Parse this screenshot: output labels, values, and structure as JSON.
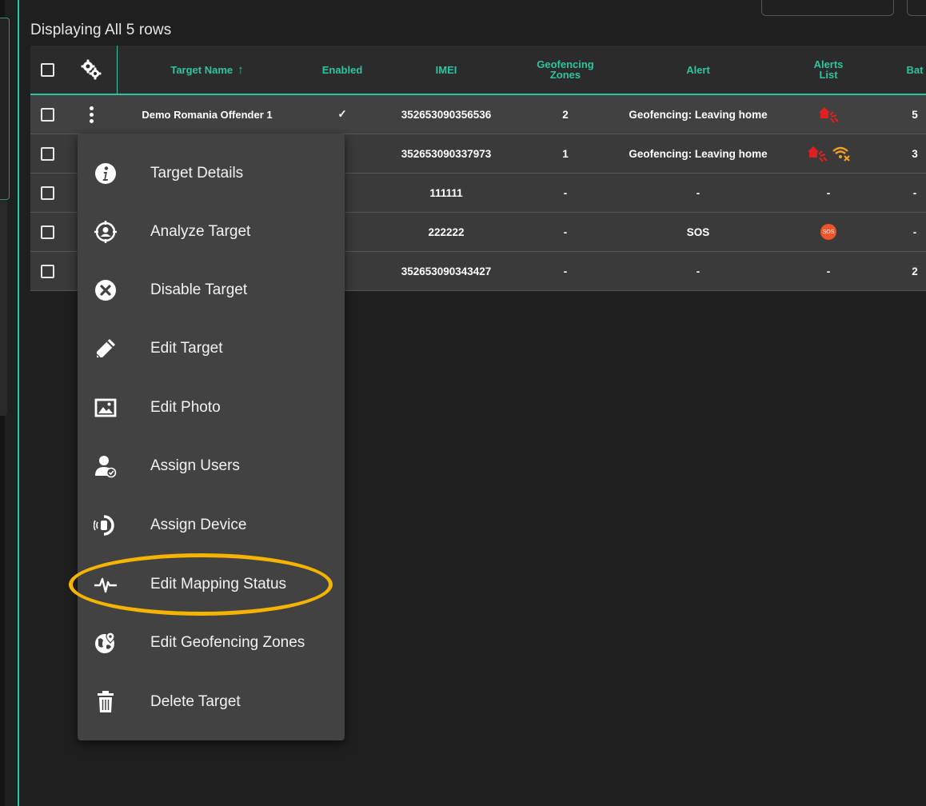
{
  "caption": "Displaying All 5 rows",
  "colors": {
    "accent": "#2ec4a0",
    "highlight": "#f5b400",
    "alert_red": "#e02020",
    "sos_orange": "#f0542a"
  },
  "table": {
    "headers": {
      "select_all": "",
      "settings_icon": "gears-icon",
      "target_name": "Target Name",
      "sort_icon": "↑",
      "enabled": "Enabled",
      "imei": "IMEI",
      "geofencing_zones_l1": "Geofencing",
      "geofencing_zones_l2": "Zones",
      "alert": "Alert",
      "alerts_list_l1": "Alerts",
      "alerts_list_l2": "List",
      "battery": "Bat"
    },
    "rows": [
      {
        "name": "Demo Romania Offender 1",
        "enabled": "✓",
        "imei": "352653090356536",
        "zones": "2",
        "alert": "Geofencing: Leaving home",
        "alerts_icons": [
          "house-alert-icon"
        ],
        "battery": "5"
      },
      {
        "name": "",
        "enabled": "",
        "imei": "352653090337973",
        "zones": "1",
        "alert": "Geofencing: Leaving home",
        "alerts_icons": [
          "house-alert-icon",
          "no-signal-icon"
        ],
        "battery": "3"
      },
      {
        "name": "",
        "enabled": "",
        "imei": "111111",
        "zones": "-",
        "alert": "-",
        "alerts_icons": [
          "-"
        ],
        "battery": "-"
      },
      {
        "name": "",
        "enabled": "",
        "imei": "222222",
        "zones": "-",
        "alert": "SOS",
        "alerts_icons": [
          "sos-icon"
        ],
        "battery": "-"
      },
      {
        "name": "",
        "enabled": "",
        "imei": "352653090343427",
        "zones": "-",
        "alert": "-",
        "alerts_icons": [
          "-"
        ],
        "battery": "2"
      }
    ],
    "sos_badge": "SOS",
    "dash": "-"
  },
  "menu": {
    "items": [
      {
        "label": "Target Details",
        "icon": "info-icon"
      },
      {
        "label": "Analyze Target",
        "icon": "target-person-icon"
      },
      {
        "label": "Disable Target",
        "icon": "close-circle-icon"
      },
      {
        "label": "Edit Target",
        "icon": "pencil-icon"
      },
      {
        "label": "Edit Photo",
        "icon": "photo-icon"
      },
      {
        "label": "Assign Users",
        "icon": "user-check-icon"
      },
      {
        "label": "Assign Device",
        "icon": "device-signal-icon"
      },
      {
        "label": "Edit Mapping Status",
        "icon": "pulse-icon",
        "highlighted": true
      },
      {
        "label": "Edit Geofencing Zones",
        "icon": "globe-pin-icon"
      },
      {
        "label": "Delete Target",
        "icon": "trash-icon"
      }
    ]
  }
}
